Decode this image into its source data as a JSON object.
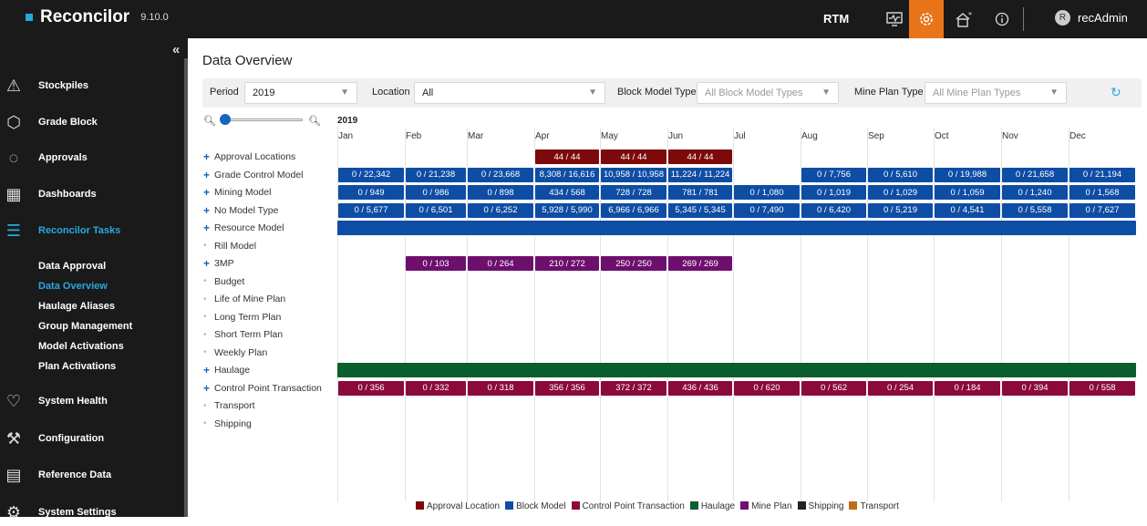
{
  "app": {
    "name": "Reconcilor",
    "version": "9.10.0"
  },
  "topbar": {
    "rtm": "RTM",
    "user": "recAdmin",
    "avatar_initial": "R",
    "icons": [
      "monitor-icon",
      "settings-gear-icon",
      "home-alert-icon",
      "info-icon"
    ]
  },
  "sidebar": {
    "collapse": "«",
    "items": [
      {
        "label": "Stockpiles",
        "icon": "stockpile-icon"
      },
      {
        "label": "Grade Block",
        "icon": "cube-icon"
      },
      {
        "label": "Approvals",
        "icon": "check-circle-icon"
      },
      {
        "label": "Dashboards",
        "icon": "dashboard-grid-icon"
      },
      {
        "label": "Reconcilor Tasks",
        "icon": "tasks-list-icon"
      },
      {
        "label": "System Health",
        "icon": "heart-pulse-icon"
      },
      {
        "label": "Configuration",
        "icon": "wrench-icon"
      },
      {
        "label": "Reference Data",
        "icon": "document-icon"
      },
      {
        "label": "System Settings",
        "icon": "settings-icon"
      }
    ],
    "subitems": [
      "Data Approval",
      "Data Overview",
      "Haulage Aliases",
      "Group Management",
      "Model Activations",
      "Plan Activations"
    ]
  },
  "page": {
    "title": "Data Overview"
  },
  "filters": {
    "period_label": "Period",
    "period_value": "2019",
    "location_label": "Location",
    "location_value": "All",
    "block_model_label": "Block Model Type",
    "block_model_value": "All Block Model Types",
    "mine_plan_label": "Mine Plan Type",
    "mine_plan_value": "All Mine Plan Types"
  },
  "timeline": {
    "year": "2019",
    "months": [
      "Jan",
      "Feb",
      "Mar",
      "Apr",
      "May",
      "Jun",
      "Jul",
      "Aug",
      "Sep",
      "Oct",
      "Nov",
      "Dec"
    ],
    "rows": [
      {
        "label": "Approval Locations",
        "expandable": true
      },
      {
        "label": "Grade Control Model",
        "expandable": true
      },
      {
        "label": "Mining Model",
        "expandable": true
      },
      {
        "label": "No Model Type",
        "expandable": true
      },
      {
        "label": "Resource Model",
        "expandable": true
      },
      {
        "label": "Rill Model",
        "expandable": false
      },
      {
        "label": "3MP",
        "expandable": true
      },
      {
        "label": "Budget",
        "expandable": false
      },
      {
        "label": "Life of Mine Plan",
        "expandable": false
      },
      {
        "label": "Long Term Plan",
        "expandable": false
      },
      {
        "label": "Short Term Plan",
        "expandable": false
      },
      {
        "label": "Weekly Plan",
        "expandable": false
      },
      {
        "label": "Haulage",
        "expandable": true
      },
      {
        "label": "Control Point Transaction",
        "expandable": true
      },
      {
        "label": "Transport",
        "expandable": false
      },
      {
        "label": "Shipping",
        "expandable": false
      }
    ],
    "cells": {
      "Approval Locations": [
        "",
        "",
        "",
        "44 / 44",
        "44 / 44",
        "44 / 44",
        "",
        "",
        "",
        "",
        "",
        ""
      ],
      "Grade Control Model": [
        "0 / 22,342",
        "0 / 21,238",
        "0 / 23,668",
        "8,308 / 16,616",
        "10,958 / 10,958",
        "11,224 / 11,224",
        "",
        "0 / 7,756",
        "0 / 5,610",
        "0 / 19,988",
        "0 / 21,658",
        "0 / 21,194"
      ],
      "Mining Model": [
        "0 / 949",
        "0 / 986",
        "0 / 898",
        "434 / 568",
        "728 / 728",
        "781 / 781",
        "0 / 1,080",
        "0 / 1,019",
        "0 / 1,029",
        "0 / 1,059",
        "0 / 1,240",
        "0 / 1,568"
      ],
      "No Model Type": [
        "0 / 5,677",
        "0 / 6,501",
        "0 / 6,252",
        "5,928 / 5,990",
        "6,966 / 6,966",
        "5,345 / 5,345",
        "0 / 7,490",
        "0 / 6,420",
        "0 / 5,219",
        "0 / 4,541",
        "0 / 5,558",
        "0 / 7,627"
      ],
      "3MP": [
        "",
        "0 / 103",
        "0 / 264",
        "210 / 272",
        "250 / 250",
        "269 / 269",
        "",
        "",
        "",
        "",
        "",
        ""
      ],
      "Control Point Transaction": [
        "0 / 356",
        "0 / 332",
        "0 / 318",
        "356 / 356",
        "372 / 372",
        "436 / 436",
        "0 / 620",
        "0 / 562",
        "0 / 254",
        "0 / 184",
        "0 / 394",
        "0 / 558"
      ]
    },
    "full_span_rows": [
      "Resource Model",
      "Haulage"
    ]
  },
  "colors": {
    "approval": "#7d0a0a",
    "block_model": "#0e4da4",
    "control_point": "#8b0a3a",
    "haulage": "#0b5e2e",
    "mine_plan": "#6e0f6e",
    "shipping": "#222222",
    "transport": "#c26a1c"
  },
  "legend": [
    {
      "label": "Approval Location",
      "color": "#7d0a0a"
    },
    {
      "label": "Block Model",
      "color": "#0e4da4"
    },
    {
      "label": "Control Point Transaction",
      "color": "#8b0a3a"
    },
    {
      "label": "Haulage",
      "color": "#0b5e2e"
    },
    {
      "label": "Mine Plan",
      "color": "#6e0f6e"
    },
    {
      "label": "Shipping",
      "color": "#222222"
    },
    {
      "label": "Transport",
      "color": "#c26a1c"
    }
  ]
}
